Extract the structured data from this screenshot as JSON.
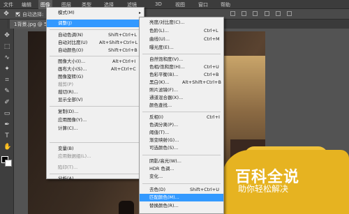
{
  "menubar": {
    "items": [
      "文件",
      "编辑",
      "图像",
      "图层",
      "类型",
      "选择",
      "滤镜",
      "3D",
      "视图",
      "窗口",
      "帮助"
    ]
  },
  "options": {
    "auto_select_label": "自动选择:"
  },
  "tab": {
    "label": "1背景.jpg @ 5..."
  },
  "image_menu": {
    "items": [
      {
        "label": "模式(M)",
        "shortcut": "",
        "arrow": "▸",
        "disabled": false
      },
      {
        "label": "调整(J)",
        "shortcut": "",
        "arrow": "▸",
        "disabled": false,
        "highlight": true
      },
      {
        "label": "自动色调(N)",
        "shortcut": "Shift+Ctrl+L",
        "arrow": "",
        "disabled": false
      },
      {
        "label": "自动对比度(U)",
        "shortcut": "Alt+Shift+Ctrl+L",
        "arrow": "",
        "disabled": false
      },
      {
        "label": "自动颜色(O)",
        "shortcut": "Shift+Ctrl+B",
        "arrow": "",
        "disabled": false
      },
      {
        "label": "图像大小(I)...",
        "shortcut": "Alt+Ctrl+I",
        "arrow": "",
        "disabled": false
      },
      {
        "label": "画布大小(S)...",
        "shortcut": "Alt+Ctrl+C",
        "arrow": "",
        "disabled": false
      },
      {
        "label": "图像旋转(G)",
        "shortcut": "",
        "arrow": "▸",
        "disabled": false
      },
      {
        "label": "裁剪(P)",
        "shortcut": "",
        "arrow": "",
        "disabled": true
      },
      {
        "label": "裁切(R)...",
        "shortcut": "",
        "arrow": "",
        "disabled": false
      },
      {
        "label": "显示全部(V)",
        "shortcut": "",
        "arrow": "",
        "disabled": false
      },
      {
        "label": "复制(D)...",
        "shortcut": "",
        "arrow": "",
        "disabled": false
      },
      {
        "label": "应用图像(Y)...",
        "shortcut": "",
        "arrow": "",
        "disabled": false
      },
      {
        "label": "计算(C)...",
        "shortcut": "",
        "arrow": "",
        "disabled": false
      },
      {
        "label": "变量(B)",
        "shortcut": "",
        "arrow": "▸",
        "disabled": false
      },
      {
        "label": "应用数据组(L)...",
        "shortcut": "",
        "arrow": "",
        "disabled": true
      },
      {
        "label": "陷印(T)...",
        "shortcut": "",
        "arrow": "",
        "disabled": true
      },
      {
        "label": "分析(A)",
        "shortcut": "",
        "arrow": "▸",
        "disabled": false
      }
    ]
  },
  "adjust_menu": {
    "items": [
      {
        "label": "亮度/对比度(C)...",
        "shortcut": ""
      },
      {
        "label": "色阶(L)...",
        "shortcut": "Ctrl+L"
      },
      {
        "label": "曲线(U)...",
        "shortcut": "Ctrl+M"
      },
      {
        "label": "曝光度(E)...",
        "shortcut": ""
      },
      {
        "label": "自然饱和度(V)...",
        "shortcut": ""
      },
      {
        "label": "色相/饱和度(H)...",
        "shortcut": "Ctrl+U"
      },
      {
        "label": "色彩平衡(B)...",
        "shortcut": "Ctrl+B"
      },
      {
        "label": "黑白(K)...",
        "shortcut": "Alt+Shift+Ctrl+B"
      },
      {
        "label": "照片滤镜(F)...",
        "shortcut": ""
      },
      {
        "label": "通道混合器(X)...",
        "shortcut": ""
      },
      {
        "label": "颜色查找...",
        "shortcut": ""
      },
      {
        "label": "反相(I)",
        "shortcut": "Ctrl+I"
      },
      {
        "label": "色调分离(P)...",
        "shortcut": ""
      },
      {
        "label": "阈值(T)...",
        "shortcut": ""
      },
      {
        "label": "渐变映射(G)...",
        "shortcut": ""
      },
      {
        "label": "可选颜色(S)...",
        "shortcut": ""
      },
      {
        "label": "阴影/高光(W)...",
        "shortcut": ""
      },
      {
        "label": "HDR 色调...",
        "shortcut": ""
      },
      {
        "label": "变化...",
        "shortcut": ""
      },
      {
        "label": "去色(D)",
        "shortcut": "Shift+Ctrl+U"
      },
      {
        "label": "匹配颜色(M)...",
        "shortcut": "",
        "highlight": true
      },
      {
        "label": "替换颜色(R)...",
        "shortcut": ""
      }
    ]
  },
  "watermark": {
    "title": "百科全说",
    "subtitle": "助你轻松解决"
  }
}
